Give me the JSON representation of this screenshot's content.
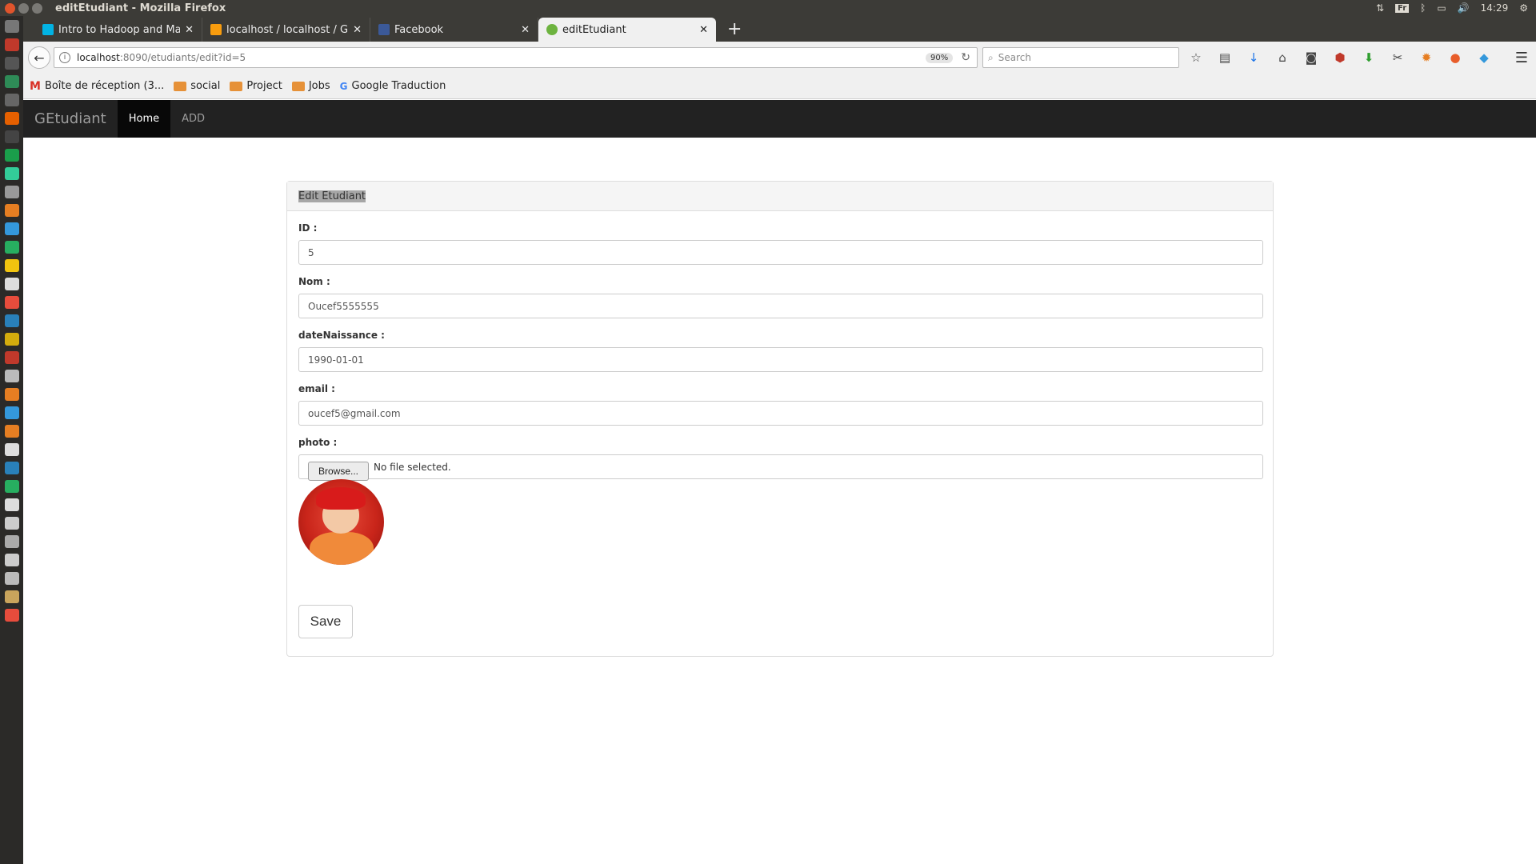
{
  "window": {
    "title": "editEtudiant - Mozilla Firefox"
  },
  "tray": {
    "keyboard": "Fr",
    "time": "14:29"
  },
  "tabs": [
    {
      "label": "Intro to Hadoop and MapR",
      "icon": "udacity-icon",
      "icon_color": "#02b3e4"
    },
    {
      "label": "localhost / localhost / GE",
      "icon": "phpmyadmin-icon",
      "icon_color": "#f89c0e"
    },
    {
      "label": "Facebook",
      "icon": "facebook-icon",
      "icon_color": "#3b5998"
    },
    {
      "label": "editEtudiant",
      "icon": "spring-leaf-icon",
      "icon_color": "#6db33f"
    }
  ],
  "urlbar": {
    "host": "localhost",
    "path": ":8090/etudiants/edit?id=5",
    "zoom": "90%"
  },
  "search": {
    "placeholder": "Search"
  },
  "bookmarks": [
    {
      "label": "Boîte de réception (3...",
      "icon": "gmail-icon"
    },
    {
      "label": "social",
      "icon": "folder-icon"
    },
    {
      "label": "Project",
      "icon": "folder-icon"
    },
    {
      "label": "Jobs",
      "icon": "folder-icon"
    },
    {
      "label": "Google Traduction",
      "icon": "google-translate-icon"
    }
  ],
  "app": {
    "brand": "GEtudiant",
    "nav": [
      {
        "label": "Home",
        "active": true
      },
      {
        "label": "ADD",
        "active": false
      }
    ]
  },
  "panel": {
    "heading": "Edit Etudiant"
  },
  "form": {
    "id_label": "ID :",
    "id_value": "5",
    "nom_label": "Nom :",
    "nom_value": "Oucef5555555",
    "date_label": "dateNaissance :",
    "date_value": "1990-01-01",
    "email_label": "email :",
    "email_value": "oucef5@gmail.com",
    "photo_label": "photo :",
    "browse_label": "Browse...",
    "no_file": "No file selected.",
    "save_label": "Save"
  },
  "colors": {
    "app_navbar": "#222222",
    "os_bar": "#3c3b37",
    "launcher": "#2b2a28"
  }
}
